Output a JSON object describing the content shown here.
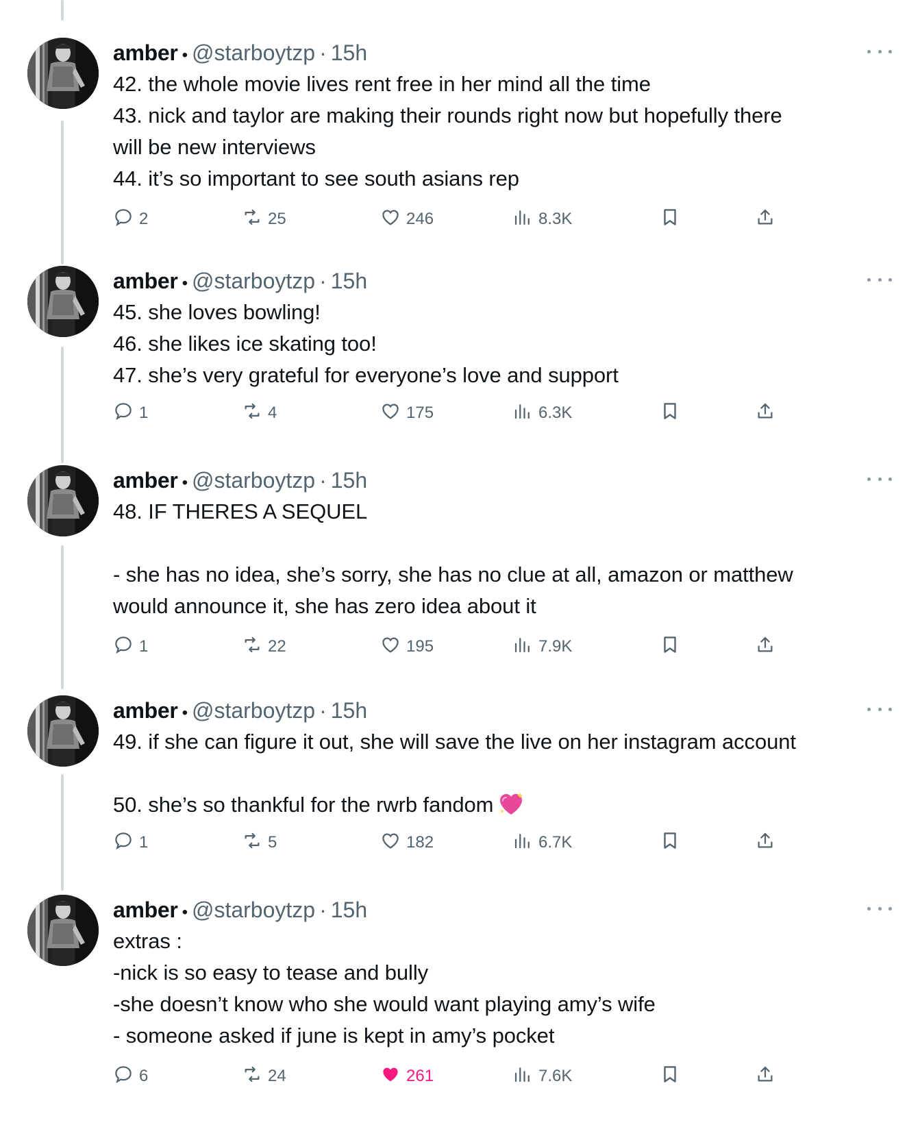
{
  "tweets": [
    {
      "name": "amber",
      "dot": "•",
      "handle": "@starboytzp",
      "sep": "·",
      "time": "15h",
      "lines": [
        "42. the whole movie lives rent free in her mind all the time",
        "43. nick and taylor are making their rounds right now but hopefully there",
        "will be new interviews",
        "44. it’s so important to see south asians rep"
      ],
      "replies": "2",
      "retweets": "25",
      "likes": "246",
      "views": "8.3K",
      "liked": false
    },
    {
      "name": "amber",
      "dot": "•",
      "handle": "@starboytzp",
      "sep": "·",
      "time": "15h",
      "lines": [
        "45. she loves bowling!",
        "46. she likes ice skating too!",
        "47. she’s very grateful for everyone’s love and support"
      ],
      "replies": "1",
      "retweets": "4",
      "likes": "175",
      "views": "6.3K",
      "liked": false
    },
    {
      "name": "amber",
      "dot": "•",
      "handle": "@starboytzp",
      "sep": "·",
      "time": "15h",
      "lines": [
        "48. IF THERES A SEQUEL",
        "",
        "- she has no idea, she’s sorry, she has no clue at all, amazon or matthew",
        "would announce it, she has zero idea about it"
      ],
      "replies": "1",
      "retweets": "22",
      "likes": "195",
      "views": "7.9K",
      "liked": false
    },
    {
      "name": "amber",
      "dot": "•",
      "handle": "@starboytzp",
      "sep": "·",
      "time": "15h",
      "lines": [
        "49. if she can figure it out, she will save the live on her instagram account",
        "",
        "50. she’s so thankful for the rwrb fandom"
      ],
      "emoji_after_last_line": "sparkling-heart-emoji",
      "replies": "1",
      "retweets": "5",
      "likes": "182",
      "views": "6.7K",
      "liked": false
    },
    {
      "name": "amber",
      "dot": "•",
      "handle": "@starboytzp",
      "sep": "·",
      "time": "15h",
      "lines": [
        "extras :",
        "-nick is so easy to tease and bully",
        "-she doesn’t know who she would want playing amy’s wife",
        "- someone asked if june is kept in amy’s pocket"
      ],
      "replies": "6",
      "retweets": "24",
      "likes": "261",
      "views": "7.6K",
      "liked": true
    }
  ],
  "icons": {
    "reply": "reply-icon",
    "retweet": "retweet-icon",
    "like": "heart-icon",
    "views": "views-icon",
    "bookmark": "bookmark-icon",
    "share": "share-icon",
    "more": "more-icon"
  },
  "colors": {
    "text": "#0f1419",
    "secondary": "#536471",
    "like_active": "#f91880",
    "thread_line": "#cfd9de"
  }
}
